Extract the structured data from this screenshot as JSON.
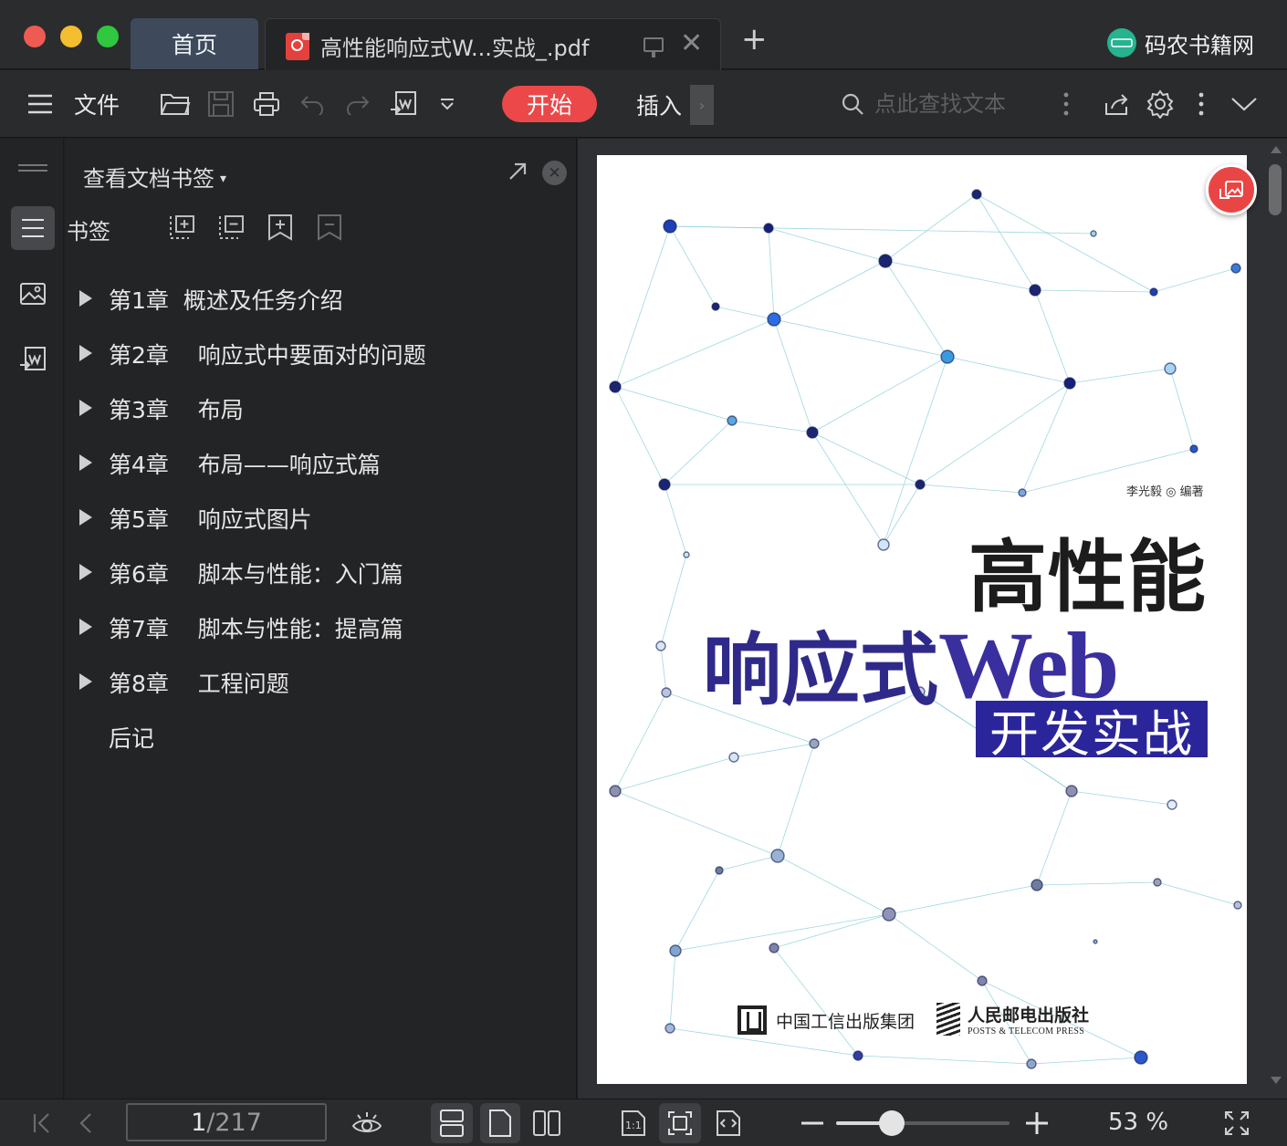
{
  "window": {
    "traffic_lights": {
      "close": "#ee5b52",
      "minimize": "#f5bd30",
      "maximize": "#2fc83e"
    },
    "tabs": [
      {
        "label": "首页"
      },
      {
        "label": "高性能响应式W...实战_.pdf"
      }
    ],
    "new_tab_label": "+",
    "close_tab_label": "✕",
    "brand": {
      "logo_text": "码农书籍网",
      "name": "码农书籍网"
    }
  },
  "toolbar": {
    "menu_label": "文件",
    "start_label": "开始",
    "insert_label": "插入",
    "scroll_chip": "›",
    "search_placeholder": "点此查找文本",
    "accent_color": "#ec4849",
    "icons": [
      "hamburger-icon",
      "open-folder-icon",
      "save-icon",
      "print-icon",
      "undo-icon",
      "redo-icon",
      "export-icon",
      "dropdown-icon",
      "search-icon",
      "more-icon",
      "share-icon",
      "settings-icon",
      "more-icon",
      "collapse-icon"
    ]
  },
  "panel": {
    "title": "查看文档书签",
    "title_caret": "▾",
    "close_label": "✕",
    "bookmark_label": "书签",
    "items": [
      {
        "label": "第1章  概述及任务介绍",
        "expandable": true
      },
      {
        "label": "第2章    响应式中要面对的问题",
        "expandable": true
      },
      {
        "label": "第3章    布局",
        "expandable": true
      },
      {
        "label": "第4章    布局——响应式篇",
        "expandable": true
      },
      {
        "label": "第5章    响应式图片",
        "expandable": true
      },
      {
        "label": "第6章    脚本与性能：入门篇",
        "expandable": true
      },
      {
        "label": "第7章    脚本与性能：提高篇",
        "expandable": true
      },
      {
        "label": "第8章    工程问题",
        "expandable": true
      },
      {
        "label": "后记",
        "expandable": false
      }
    ]
  },
  "document": {
    "author": "李光毅 ◎ 编著",
    "title_line1": "高性能",
    "title_line2_cn": "响应式",
    "title_line2_en": "Web",
    "title_line3": "开发实战",
    "publisher1": "中国工信出版集团",
    "publisher2_cn": "人民邮电出版社",
    "publisher2_en": "POSTS & TELECOM PRESS",
    "page_bg": "#ffffff"
  },
  "status": {
    "current_page": "1",
    "page_separator": "/217",
    "zoom_text": "53 %",
    "zoom_fraction": 0.32
  }
}
